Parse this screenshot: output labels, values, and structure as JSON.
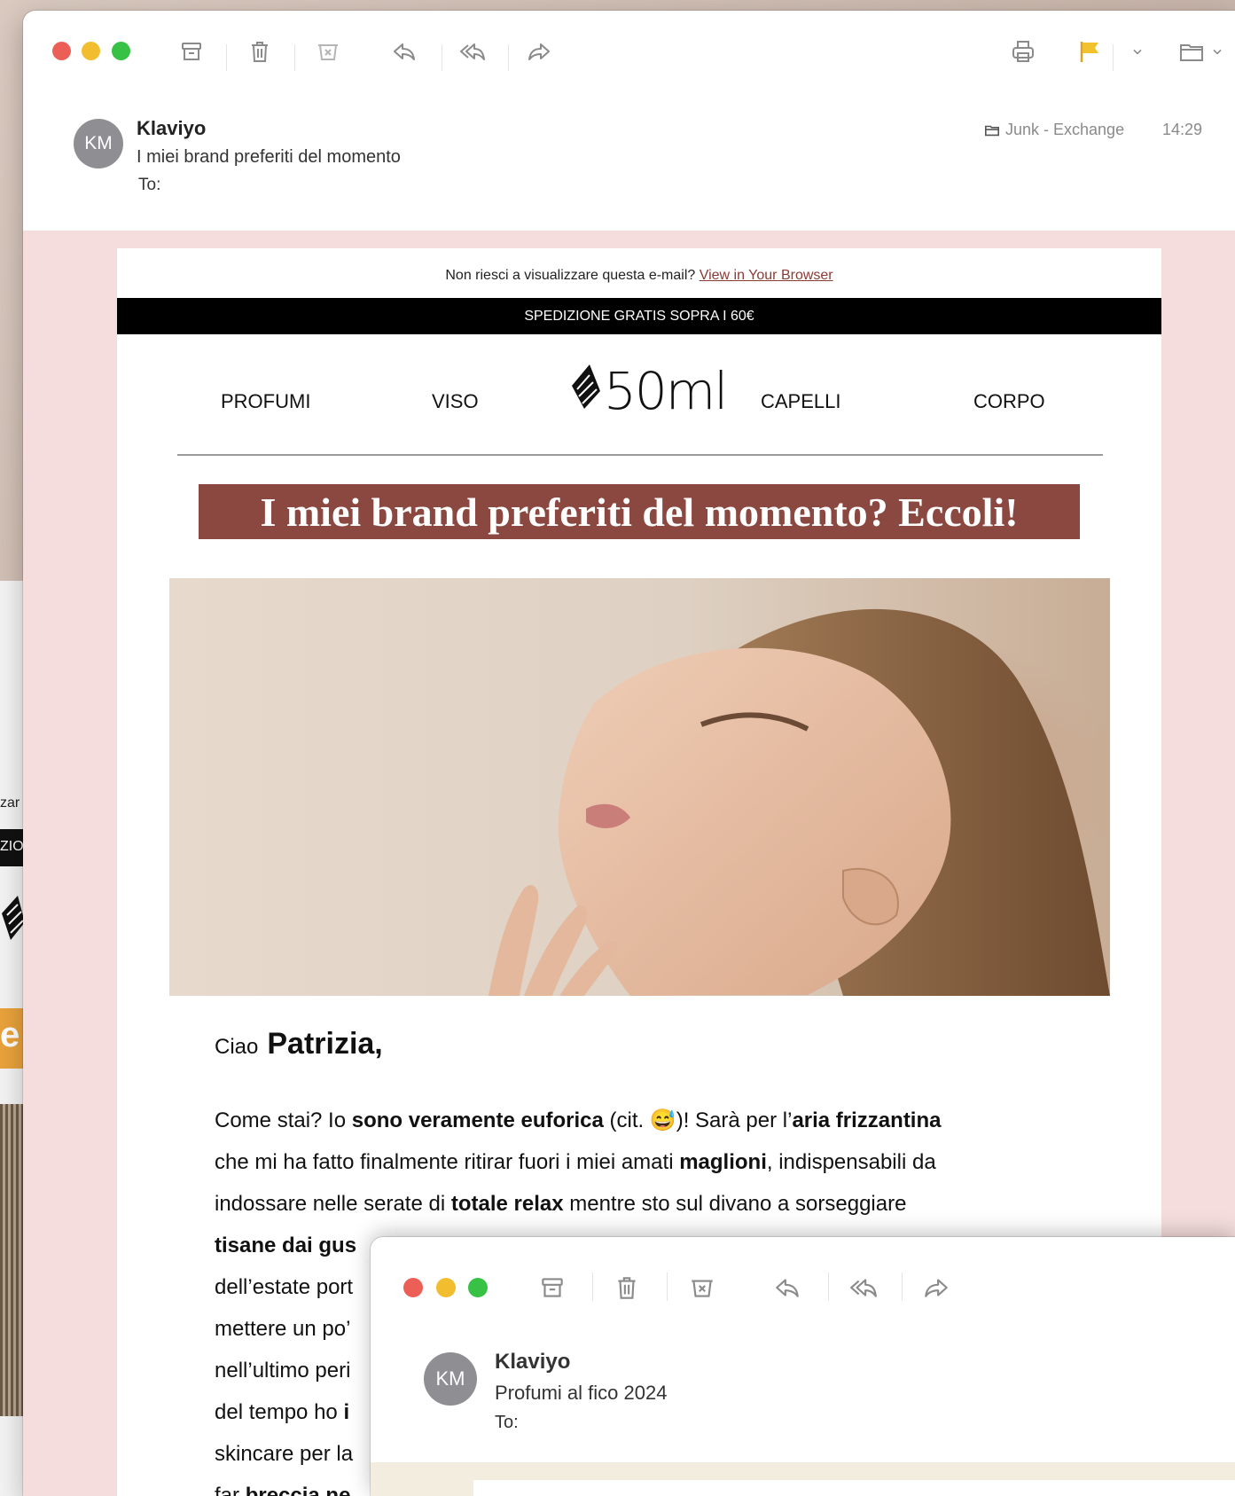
{
  "background_window": {
    "fragment_1": "zar",
    "fragment_2": "ZIO",
    "fragment_3": "e"
  },
  "main_window": {
    "toolbar": {
      "archive": "archive-icon",
      "trash": "trash-icon",
      "junk": "junk-icon",
      "reply": "reply-icon",
      "reply_all": "reply-all-icon",
      "forward": "forward-icon",
      "print": "print-icon",
      "flag": "flag-icon",
      "flag_color": "#f2c12e",
      "move": "folder-icon"
    },
    "message": {
      "avatar_initials": "KM",
      "sender": "Klaviyo",
      "subject": "I miei brand preferiti del momento",
      "to_label": "To:",
      "mailbox": "Junk - Exchange",
      "time": "14:29"
    },
    "email": {
      "preheader_text": "Non riesci a visualizzare questa e-mail? ",
      "preheader_link": "View in Your Browser",
      "shipping_banner": "SPEDIZIONE GRATIS SOPRA I 60€",
      "nav": [
        "PROFUMI",
        "VISO",
        "CAPELLI",
        "CORPO"
      ],
      "logo_text": "50ml",
      "headline": "I miei brand preferiti del momento? Eccoli!",
      "headline_bg": "#8b4840",
      "greeting_prefix": "Ciao",
      "greeting_name": "Patrizia,",
      "paragraph": {
        "l1_a": "Come stai? Io ",
        "l1_b": "sono veramente euforica",
        "l1_c": " (cit. 😅)! Sarà per l’",
        "l1_d": "aria frizzantina",
        "l2_a": "che mi ha fatto finalmente ritirar fuori i miei amati ",
        "l2_b": "maglioni",
        "l2_c": ", indispensabili da",
        "l3_a": "indossare nelle serate di ",
        "l3_b": "totale relax",
        "l3_c": " mentre sto sul divano a sorseggiare",
        "l4_a": "tisane dai gus",
        "l5": "dell’estate port",
        "l6": "mettere un po’",
        "l7": "nell’ultimo peri",
        "l8_a": "del tempo ho ",
        "l8_b": "i",
        "l9": "skincare per la",
        "l10_a": "far ",
        "l10_b": "breccia ne"
      }
    }
  },
  "overlay_window": {
    "avatar_initials": "KM",
    "sender": "Klaviyo",
    "subject": "Profumi al fico 2024",
    "to_label": "To:"
  }
}
